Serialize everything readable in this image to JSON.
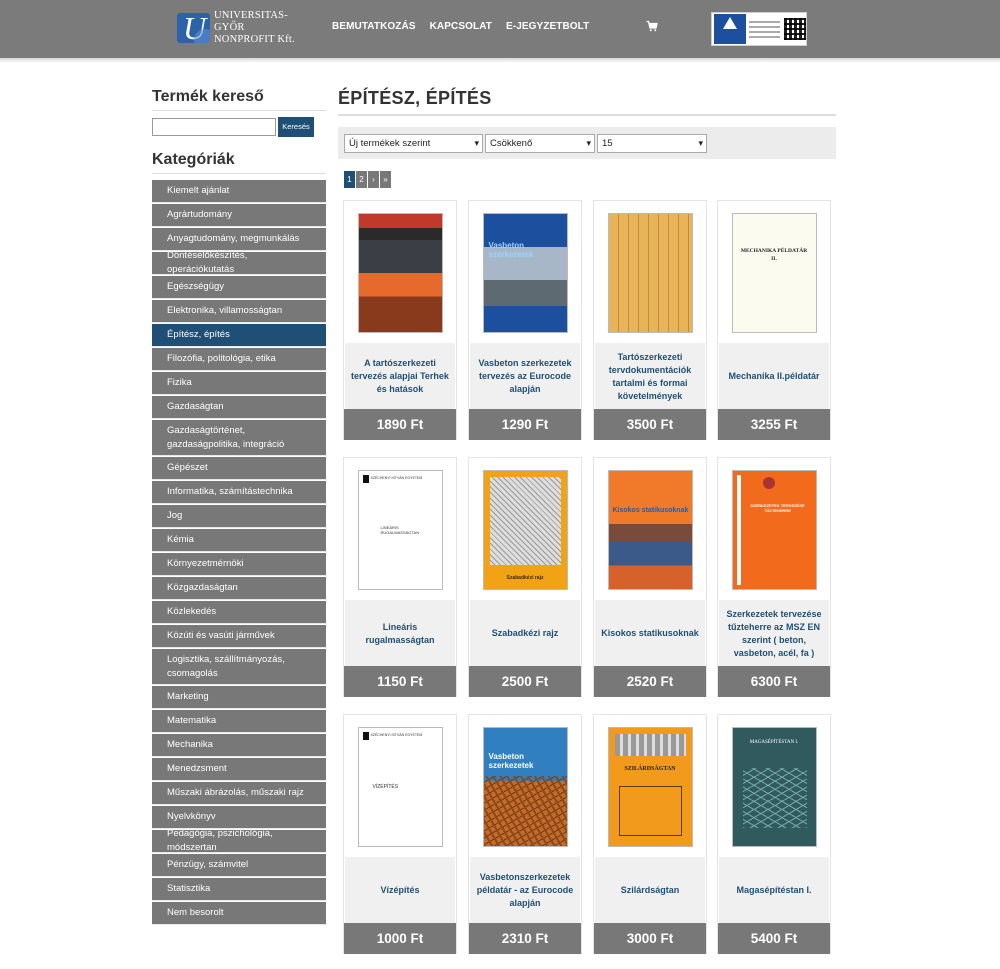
{
  "header": {
    "logo_line1": "UNIVERSITAS-GYŐR",
    "logo_line2": "NONPROFIT Kft.",
    "nav": [
      "BEMUTATKOZÁS",
      "KAPCSOLAT",
      "E-JEGYZETBOLT"
    ]
  },
  "sidebar": {
    "search_title": "Termék kereső",
    "search_button": "Keresés",
    "search_value": "",
    "categories_title": "Kategóriák",
    "categories": [
      {
        "label": "Kiemelt ajánlat"
      },
      {
        "label": "Agrártudomány"
      },
      {
        "label": "Anyagtudomány, megmunkálás"
      },
      {
        "label": "Döntéselőkészítés, operációkutatás"
      },
      {
        "label": "Egészségügy"
      },
      {
        "label": "Elektronika, villamosságtan"
      },
      {
        "label": "Építész, építés"
      },
      {
        "label": "Filozófia, politológia, etika"
      },
      {
        "label": "Fizika"
      },
      {
        "label": "Gazdaságtan"
      },
      {
        "label": "Gazdaságtörténet, gazdaságpolitika, integráció"
      },
      {
        "label": "Gépészet"
      },
      {
        "label": "Informatika, számítástechnika"
      },
      {
        "label": "Jog"
      },
      {
        "label": "Kémia"
      },
      {
        "label": "Környezetmérnöki"
      },
      {
        "label": "Közgazdaságtan"
      },
      {
        "label": "Közlekedés"
      },
      {
        "label": "Közúti és vasúti járművek"
      },
      {
        "label": "Logisztika, szállítmányozás, csomagolás"
      },
      {
        "label": "Marketing"
      },
      {
        "label": "Matematika"
      },
      {
        "label": "Mechanika"
      },
      {
        "label": "Menedzsment"
      },
      {
        "label": "Műszaki ábrázolás, műszaki rajz"
      },
      {
        "label": "Nyelvkönyv"
      },
      {
        "label": "Pedagógia, pszichológia, módszertan"
      },
      {
        "label": "Pénzügy, számvitel"
      },
      {
        "label": "Statisztika"
      },
      {
        "label": "Nem besorolt"
      }
    ]
  },
  "main": {
    "title": "ÉPÍTÉSZ, ÉPÍTÉS",
    "sort_by": "Új termékek szerint",
    "order": "Csökkenő",
    "per_page": "15",
    "pages": [
      "1",
      "2",
      "›",
      "»"
    ],
    "products": [
      {
        "name": "A tartószerkezeti tervezés alapjai Terhek és hatások",
        "price": "1890 Ft"
      },
      {
        "name": "Vasbeton szerkezetek tervezés az Eurocode alapján",
        "price": "1290 Ft"
      },
      {
        "name": "Tartószerkezeti tervdokumentációk tartalmi és formai követelmények",
        "price": "3500 Ft"
      },
      {
        "name": "Mechanika II.példatár",
        "price": "3255 Ft"
      },
      {
        "name": "Lineáris rugalmasságtan",
        "price": "1150 Ft"
      },
      {
        "name": "Szabadkézi rajz",
        "price": "2500 Ft"
      },
      {
        "name": "Kisokos statikusoknak",
        "price": "2520 Ft"
      },
      {
        "name": "Szerkezetek tervezése tűzteherre az MSZ EN szerint ( beton, vasbeton, acél, fa )",
        "price": "6300 Ft"
      },
      {
        "name": "Vízépítés",
        "price": "1000 Ft"
      },
      {
        "name": "Vasbetonszerkezetek példatár - az Eurocode alapján",
        "price": "2310 Ft"
      },
      {
        "name": "Szilárdságtan",
        "price": "3000 Ft"
      },
      {
        "name": "Magasépítéstan I.",
        "price": "5400 Ft"
      }
    ],
    "cover_texts": {
      "c2": "Vasbeton szerkezetek",
      "c4a": "MECHANIKA PÉLDATÁR",
      "c4b": "II.",
      "c5a": "SZÉCHENYI ISTVÁN EGYETEM",
      "c5b": "LINEÁRIS RUGALMASSÁGTAN",
      "c6": "Szabadkézi rajz",
      "c7": "Kisokos statikusoknak",
      "c8": "SZERKEZETEK TERVEZÉSE TŰZTEHERRE",
      "c9a": "SZÉCHENYI ISTVÁN EGYETEM",
      "c9b": "VÍZÉPÍTÉS",
      "c10": "Vasbeton szerkezetek",
      "c11": "SZILÁRDSÁGTAN",
      "c12": "MAGASÉPÍTÉSTAN I."
    }
  }
}
